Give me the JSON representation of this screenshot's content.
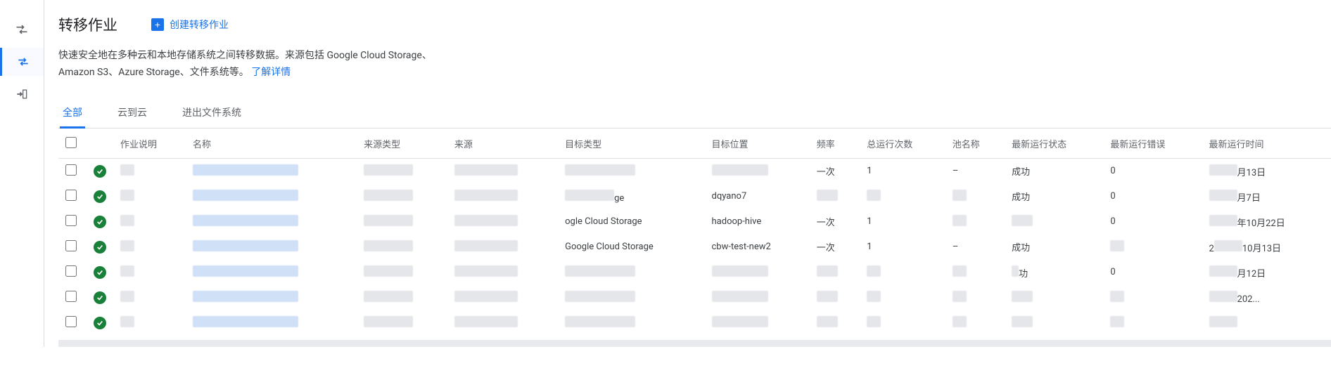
{
  "page": {
    "title": "转移作业",
    "create_label": "创建转移作业",
    "description_1": "快速安全地在多种云和本地存储系统之间转移数据。来源包括 Google Cloud Storage、",
    "description_2": "Amazon S3、Azure Storage、文件系统等。",
    "learn_more": "了解详情"
  },
  "tabs": [
    {
      "label": "全部",
      "active": true
    },
    {
      "label": "云到云",
      "active": false
    },
    {
      "label": "进出文件系统",
      "active": false
    }
  ],
  "columns": {
    "desc": "作业说明",
    "name": "名称",
    "source_type": "来源类型",
    "source": "来源",
    "target_type": "目标类型",
    "target_loc": "目标位置",
    "freq": "频率",
    "runs": "总运行次数",
    "pool": "池名称",
    "last_state": "最新运行状态",
    "last_error": "最新运行错误",
    "last_time": "最新运行时间"
  },
  "rows": [
    {
      "target_type": "",
      "target_loc": "",
      "freq": "一次",
      "runs": "1",
      "pool": "–",
      "state": "成功",
      "error": "0",
      "time_suffix": "月13日"
    },
    {
      "target_type_suffix": "ge",
      "target_loc": "dqyano7",
      "freq": "",
      "runs": "",
      "pool": "",
      "state": "成功",
      "error": "0",
      "time_suffix": "月7日"
    },
    {
      "target_type_prefix": "ogle Cloud Storage",
      "target_loc": "hadoop-hive",
      "freq": "一次",
      "runs": "1",
      "pool": "",
      "state": "",
      "error": "0",
      "time_suffix": "年10月22日"
    },
    {
      "target_type_prefix": "Google Cloud Storage",
      "target_loc": "cbw-test-new2",
      "freq": "一次",
      "runs": "1",
      "pool": "–",
      "state": "成功",
      "error": "",
      "time_prefix": "2",
      "time_suffix": "10月13日"
    },
    {
      "target_type": "",
      "target_loc": "",
      "freq": "",
      "runs": "",
      "pool": "",
      "state_suffix": "功",
      "error": "0",
      "time_suffix": "月12日"
    },
    {
      "target_type": "",
      "target_loc": "",
      "freq": "",
      "runs": "",
      "pool": "",
      "state": "",
      "error": "",
      "time_suffix": "202..."
    },
    {
      "target_type": "",
      "target_loc": "",
      "freq": "",
      "runs": "",
      "pool": "",
      "state": "",
      "error": "",
      "time": ""
    }
  ]
}
